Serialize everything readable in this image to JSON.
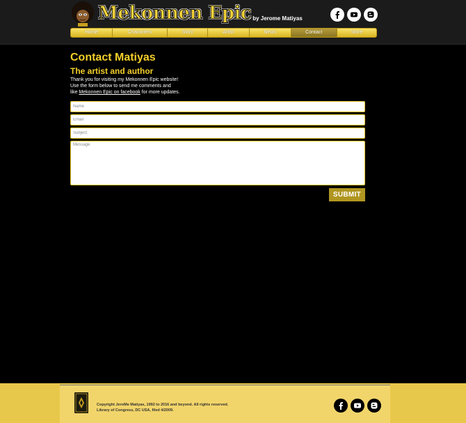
{
  "header": {
    "logo_text": "Mekonnen Epic",
    "byline": "by Jerome Matiyas",
    "social": [
      "facebook-icon",
      "youtube-icon",
      "blogger-icon"
    ]
  },
  "nav": {
    "items": [
      {
        "label": "Home"
      },
      {
        "label": "Characters"
      },
      {
        "label": "Story"
      },
      {
        "label": "Artist"
      },
      {
        "label": "News"
      },
      {
        "label": "Contact"
      },
      {
        "label": "Store"
      }
    ],
    "active": "Contact"
  },
  "main": {
    "title": "Contact Matiyas",
    "subtitle": "The artist and author",
    "intro_line1": "Thank you for visiting my Mekonnen Epic website!",
    "intro_line2": "Use the form below to send me comments and",
    "intro_line3_prefix": "like ",
    "intro_link": "Mekonnen Epic on facebook",
    "intro_line3_suffix": " for more updates."
  },
  "form": {
    "name_placeholder": "Name",
    "email_placeholder": "Email",
    "subject_placeholder": "Subject",
    "message_placeholder": "Message",
    "submit_label": "SUBMIT"
  },
  "footer": {
    "copyright_line1": "Copyright JeroMe Matiyas, 1992 to 2016 and beyond. All rights reserved.",
    "copyright_line2": "Library of Congress, DC USA, filed 4/2009.",
    "social": [
      "facebook-icon",
      "youtube-icon",
      "blogger-icon"
    ]
  },
  "colors": {
    "accent": "#f4cf2a",
    "nav_gold": "#e8c52a",
    "footer_bg": "#e8c84a",
    "submit_bg": "#b09620",
    "background": "#000000"
  }
}
